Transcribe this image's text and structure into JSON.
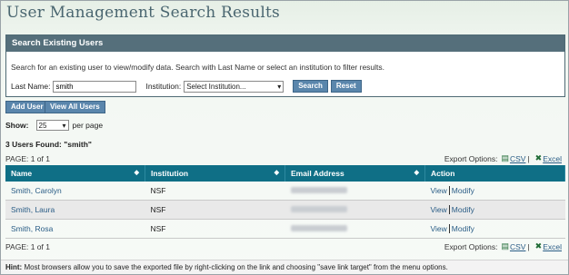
{
  "page": {
    "title": "User Management Search Results"
  },
  "search_panel": {
    "header": "Search Existing Users",
    "description": "Search for an existing user to view/modify data. Search with Last Name or select an institution to filter results.",
    "last_name_label": "Last Name:",
    "last_name_value": "smith",
    "institution_label": "Institution:",
    "institution_selected": "Select Institution...",
    "search_button": "Search",
    "reset_button": "Reset"
  },
  "actions": {
    "add_user": "Add User",
    "view_all_users": "View All Users"
  },
  "pagination": {
    "show_label": "Show:",
    "per_page_value": "25",
    "per_page_suffix": "per page",
    "page_info": "PAGE: 1 of 1"
  },
  "results_found": "3 Users Found: \"smith\"",
  "export": {
    "label": "Export Options:",
    "csv": "CSV",
    "excel": "Excel",
    "separator": "|"
  },
  "table": {
    "columns": [
      "Name",
      "Institution",
      "Email Address",
      "Action"
    ],
    "rows": [
      {
        "name": "Smith, Carolyn",
        "institution": "NSF",
        "view": "View",
        "modify": "Modify"
      },
      {
        "name": "Smith, Laura",
        "institution": "NSF",
        "view": "View",
        "modify": "Modify"
      },
      {
        "name": "Smith, Rosa",
        "institution": "NSF",
        "view": "View",
        "modify": "Modify"
      }
    ]
  },
  "hint": {
    "label": "Hint:",
    "text": "Most browsers allow you to save the exported file by right-clicking on the link and choosing \"save link target\" from the menu options."
  },
  "icons": {
    "csv": "csv-file-icon",
    "excel": "excel-file-icon",
    "sort": "sort-arrows-icon",
    "dropdown": "chevron-down-icon"
  }
}
